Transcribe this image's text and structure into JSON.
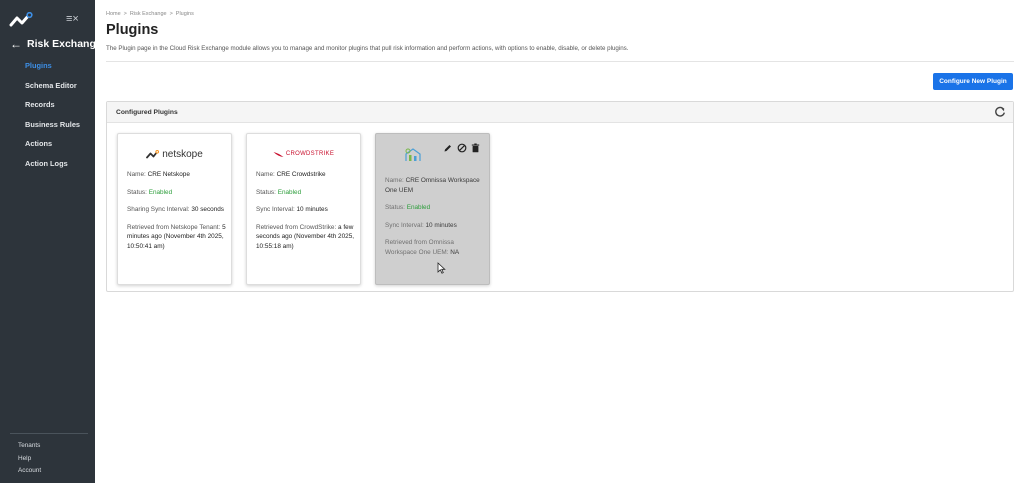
{
  "sidebar": {
    "back_label": "Risk Exchange",
    "nav": [
      {
        "label": "Plugins",
        "active": true
      },
      {
        "label": "Schema Editor",
        "active": false
      },
      {
        "label": "Records",
        "active": false
      },
      {
        "label": "Business Rules",
        "active": false
      },
      {
        "label": "Actions",
        "active": false
      },
      {
        "label": "Action Logs",
        "active": false
      }
    ],
    "footer": [
      "Tenants",
      "Help",
      "Account"
    ]
  },
  "breadcrumb": [
    "Home",
    "Risk Exchange",
    "Plugins"
  ],
  "breadcrumb_sep": ">",
  "page": {
    "title": "Plugins",
    "description": "The Plugin page in the Cloud Risk Exchange module allows you to manage and monitor plugins that pull risk information and perform actions, with options to enable, disable, or delete plugins.",
    "configure_button": "Configure New Plugin"
  },
  "panel": {
    "title": "Configured Plugins"
  },
  "cards": [
    {
      "logo_text": "netskope",
      "name_label": "Name:",
      "name": "CRE Netskope",
      "status_label": "Status:",
      "status": "Enabled",
      "interval_label": "Sharing Sync Interval:",
      "interval": "30 seconds",
      "retrieved_label": "Retrieved from Netskope Tenant:",
      "retrieved": "5 minutes ago (November 4th 2025, 10:50:41 am)"
    },
    {
      "logo_text": "CROWDSTRIKE",
      "name_label": "Name:",
      "name": "CRE Crowdstrike",
      "status_label": "Status:",
      "status": "Enabled",
      "interval_label": "Sync Interval:",
      "interval": "10 minutes",
      "retrieved_label": "Retrieved from CrowdStrike:",
      "retrieved": "a few seconds ago (November 4th 2025, 10:55:18 am)"
    },
    {
      "logo_text": "Workspace ONE UEM",
      "name_label": "Name:",
      "name": "CRE Omnissa Workspace One UEM",
      "status_label": "Status:",
      "status": "Enabled",
      "interval_label": "Sync Interval:",
      "interval": "10 minutes",
      "retrieved_label": "Retrieved from Omnissa Workspace One UEM:",
      "retrieved": "NA"
    }
  ],
  "colors": {
    "sidebar_bg": "#2d343b",
    "accent": "#1a73e8",
    "active_nav": "#3d8fe6",
    "enabled": "#2e9e3c",
    "disabled_card": "#cfcfcf"
  },
  "icons": [
    "netskope-logo-icon",
    "collapse-menu-icon",
    "back-arrow-icon",
    "refresh-icon",
    "edit-icon",
    "disable-icon",
    "delete-icon",
    "crowdstrike-logo-icon",
    "workspace-one-logo-icon",
    "mouse-cursor-icon"
  ]
}
